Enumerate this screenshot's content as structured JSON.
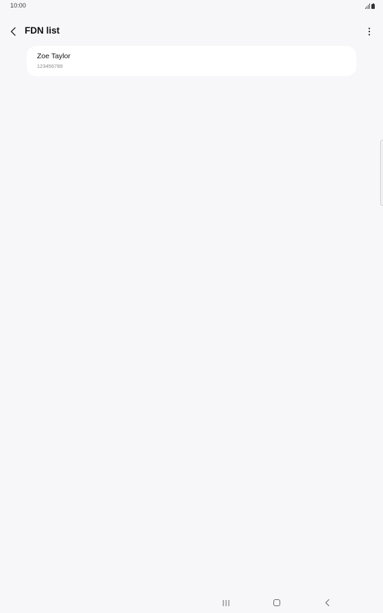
{
  "status_bar": {
    "time": "10:00",
    "icons": [
      "signal-icon",
      "battery-icon"
    ]
  },
  "header": {
    "title": "FDN list",
    "back_icon": "back-arrow-icon",
    "more_icon": "more-vertical-icon"
  },
  "fdn_list": {
    "items": [
      {
        "name": "Zoe Taylor",
        "number": "123456789"
      }
    ]
  },
  "navigation_bar": {
    "buttons": [
      "recents-icon",
      "home-icon",
      "back-icon"
    ]
  },
  "colors": {
    "background": "#f7f7f9",
    "card": "#ffffff",
    "primary_text": "#111111",
    "secondary_text": "#8a8a8a"
  }
}
